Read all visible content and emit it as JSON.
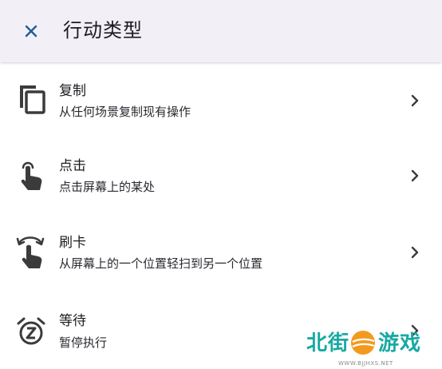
{
  "header": {
    "title": "行动类型",
    "close_icon": "close-icon"
  },
  "action_types": [
    {
      "label": "复制",
      "description": "从任何场景复制现有操作",
      "icon": "copy-icon"
    },
    {
      "label": "点击",
      "description": "点击屏幕上的某处",
      "icon": "tap-gesture-icon"
    },
    {
      "label": "刷卡",
      "description": "从屏幕上的一个位置轻扫到另一个位置",
      "icon": "swipe-gesture-icon"
    },
    {
      "label": "等待",
      "description": "暂停执行",
      "icon": "snooze-alarm-icon"
    }
  ],
  "watermark": {
    "text_left": "北街",
    "text_right": "游戏",
    "url": "WWW.BJJHXS.NET"
  },
  "colors": {
    "app_bar": "#f3eff6",
    "accent": "#1a5e9a",
    "icon": "#3b3b3b",
    "watermark": "#19a9a3",
    "watermark_orange": "#f39a1e"
  }
}
